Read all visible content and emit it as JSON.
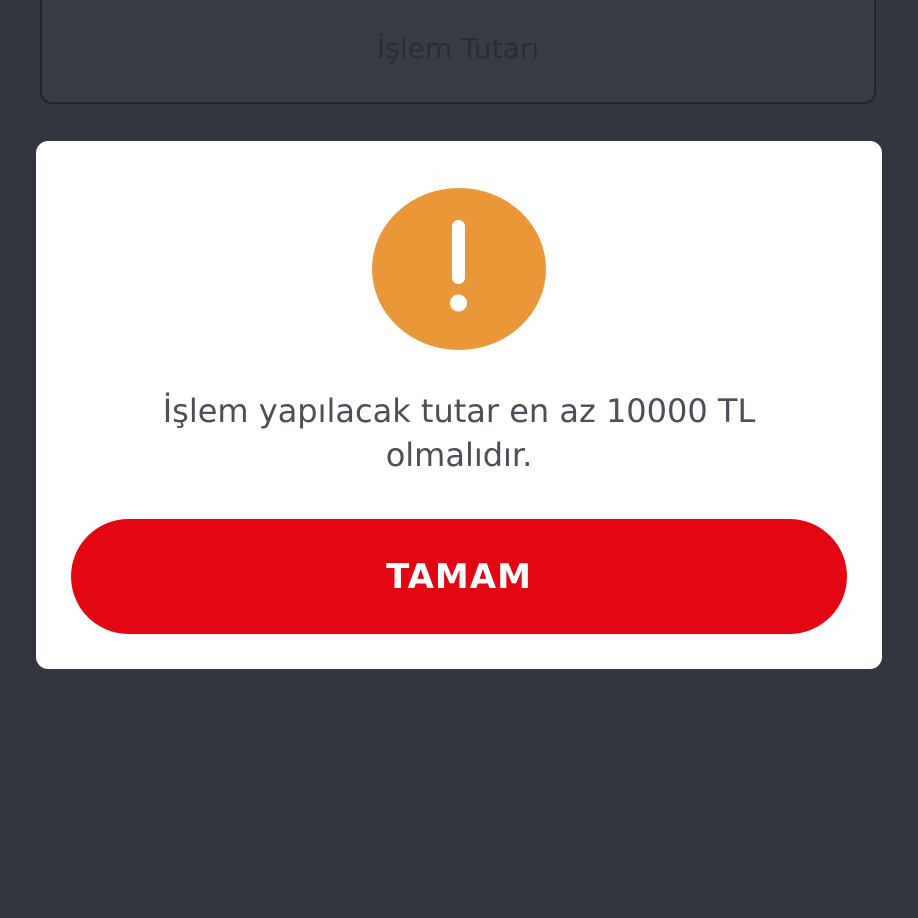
{
  "background": {
    "field_label": "İşlem Tutarı"
  },
  "dialog": {
    "icon": "exclamation-icon",
    "message_line1": "İşlem yapılacak tutar en az 10000 TL",
    "message_line2": "olmalıdır.",
    "ok_label": "TAMAM"
  },
  "colors": {
    "background": "#34363f",
    "warning": "#e99738",
    "primary_button": "#e20613",
    "text": "#4a4f58"
  }
}
